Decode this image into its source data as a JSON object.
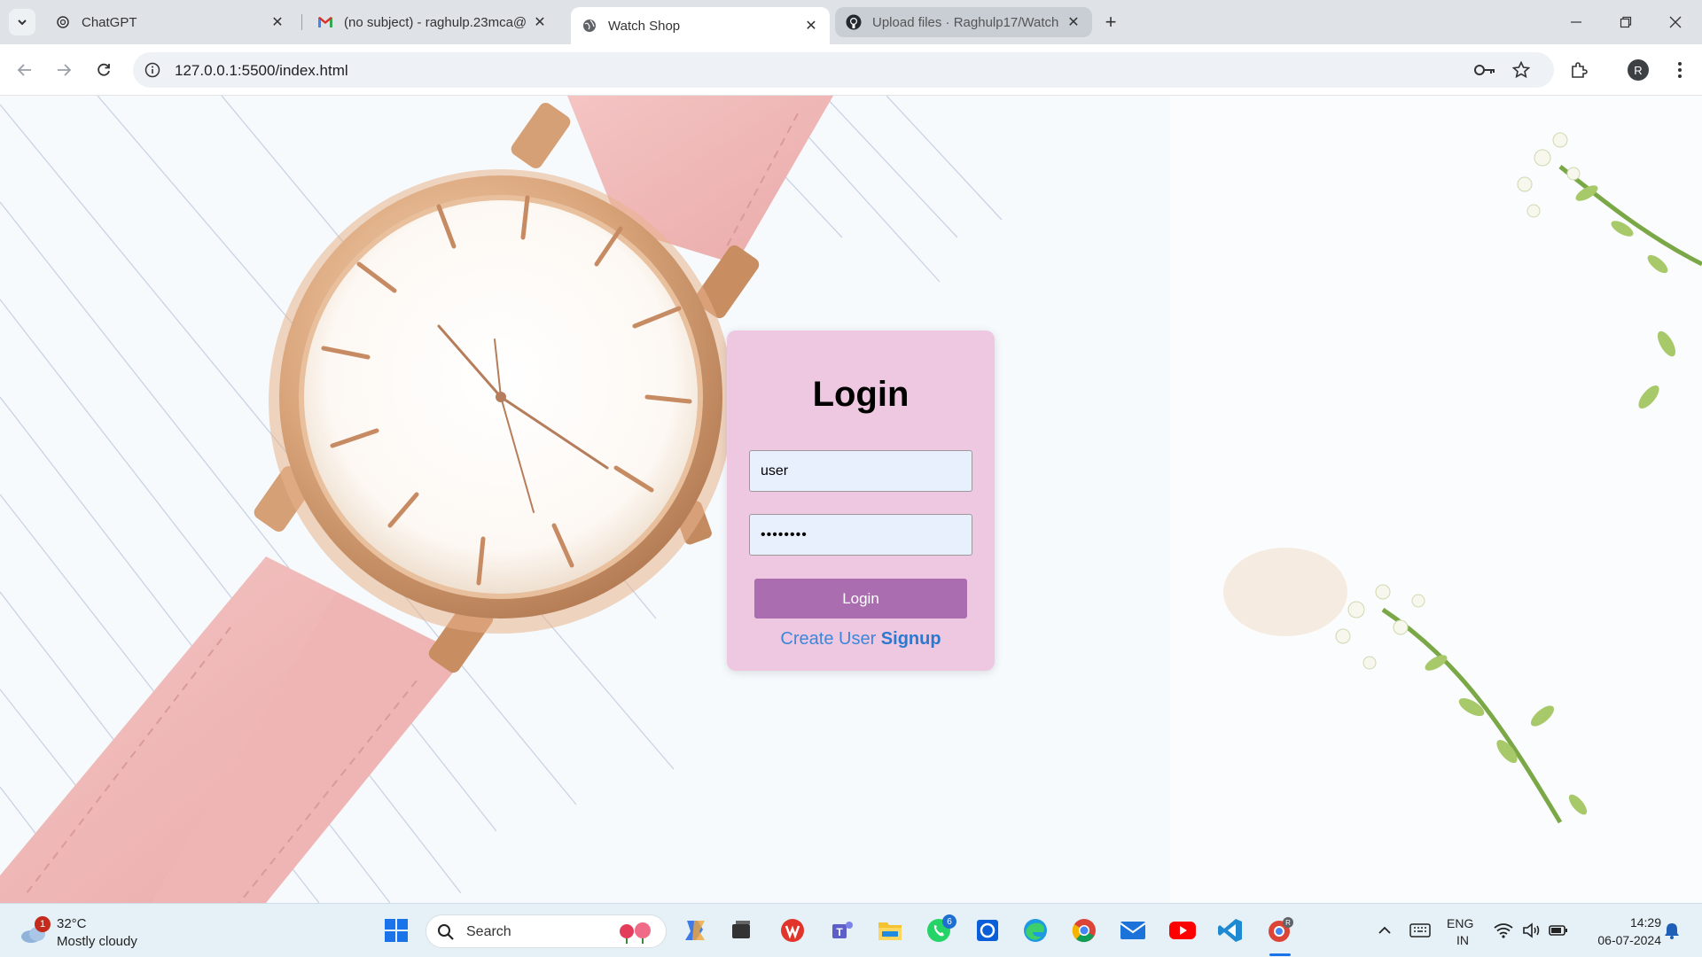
{
  "browser": {
    "tabs": [
      {
        "title": "ChatGPT",
        "favicon": "chatgpt-icon",
        "state": "normal"
      },
      {
        "title": "(no subject) - raghulp.23mca@",
        "favicon": "gmail-icon",
        "state": "normal"
      },
      {
        "title": "Watch Shop",
        "favicon": "globe-icon",
        "state": "active"
      },
      {
        "title": "Upload files · Raghulp17/Watch",
        "favicon": "github-icon",
        "state": "hovered"
      }
    ],
    "url": "127.0.0.1:5500/index.html",
    "profile_initial": "R"
  },
  "login": {
    "title": "Login",
    "username_value": "user",
    "password_value": "••••••••",
    "button_label": "Login",
    "signup_prefix": "Create User ",
    "signup_link": "Signup"
  },
  "colors": {
    "card_bg": "#edc8e0",
    "button_bg": "#a96db0",
    "link": "#3e86d8"
  },
  "taskbar": {
    "weather_temp": "32°C",
    "weather_condition": "Mostly cloudy",
    "weather_badge": "1",
    "search_label": "Search",
    "whatsapp_badge": "6",
    "language_line1": "ENG",
    "language_line2": "IN",
    "time": "14:29",
    "date": "06-07-2024"
  }
}
